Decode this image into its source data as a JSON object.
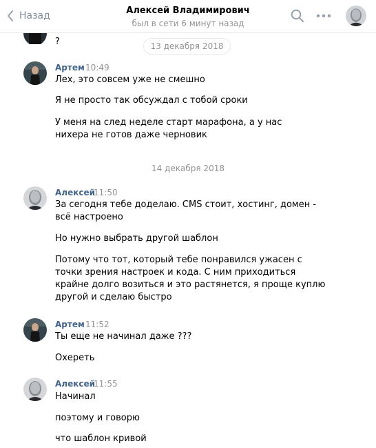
{
  "header": {
    "back_label": "Назад",
    "contact_name": "Алексей Владимирович",
    "status": "был в сети 6 минут назад"
  },
  "icons": {
    "back": "chevron-left-icon",
    "search": "search-icon",
    "more": "more-horizontal-icon"
  },
  "colors": {
    "author_name": "#42648b",
    "muted": "#939393",
    "back": "#818c99"
  },
  "chat": {
    "top_fragment": "?",
    "date_1": "13 декабря 2018",
    "date_2": "14 декабря 2018",
    "groups": [
      {
        "author": "Артем",
        "time": "10:49",
        "messages": [
          "Лех, это совсем уже не смешно",
          "Я не просто так обсуждал с тобой сроки",
          "У меня на след неделе старт марафона, а у нас нихера не готов даже черновик"
        ]
      },
      {
        "author": "Алексей",
        "time": "11:50",
        "messages": [
          "За сегодня тебе доделаю. CMS стоит, хостинг, домен - всё настроено",
          "Но нужно выбрать другой шаблон",
          "Потому что тот, который тебе понравился ужасен с точки зрения настроек и кода. С ним приходиться крайне долго возиться и это растянется, я проще куплю другой и сделаю быстро"
        ]
      },
      {
        "author": "Артем",
        "time": "11:52",
        "messages": [
          "Ты еще не начинал даже ???",
          "Охереть"
        ]
      },
      {
        "author": "Алексей",
        "time": "11:55",
        "messages": [
          "Начинал",
          "поэтому и говорю",
          "что шаблон кривой"
        ]
      }
    ]
  }
}
